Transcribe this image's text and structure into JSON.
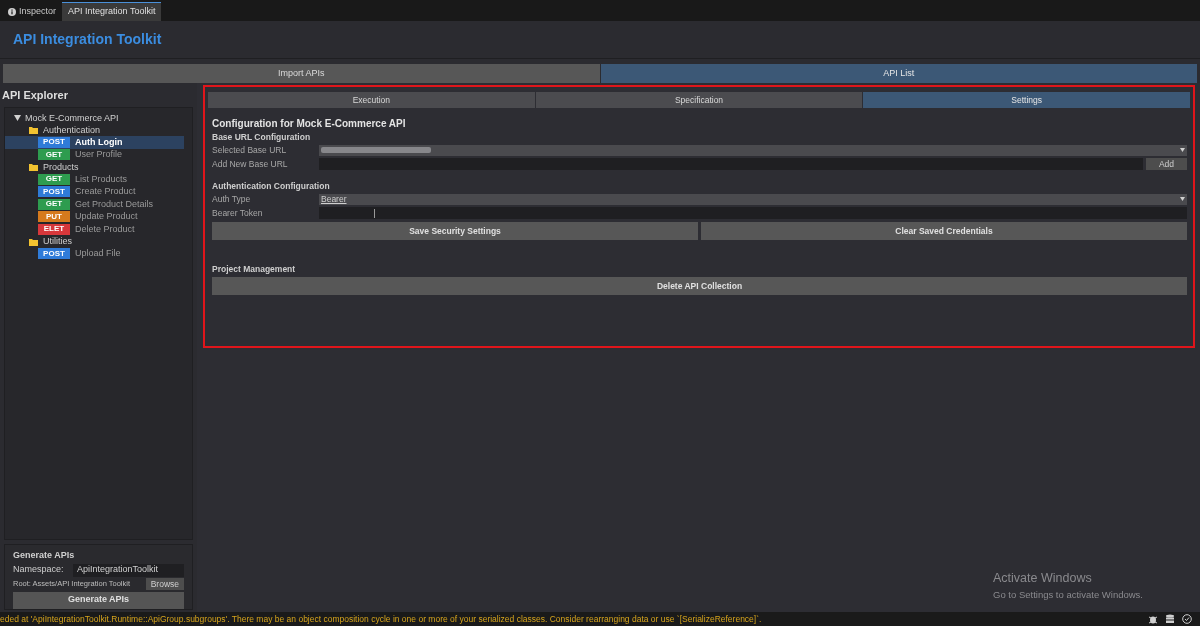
{
  "window_tabs": [
    {
      "label": "Inspector",
      "kind": "info",
      "selected": false
    },
    {
      "label": "API Integration Toolkit",
      "selected": true
    }
  ],
  "header": {
    "title": "API Integration Toolkit"
  },
  "main_tabs": [
    {
      "label": "Import APIs",
      "selected": false
    },
    {
      "label": "API List",
      "selected": true
    }
  ],
  "sidebar": {
    "title": "API Explorer",
    "tree": [
      {
        "label": "Mock E-Commerce API",
        "kind": "root",
        "expanded": true,
        "children": [
          {
            "label": "Authentication",
            "kind": "folder",
            "children": [
              {
                "label": "Auth Login",
                "kind": "endpoint",
                "method": "POST",
                "color": "#2f7bd8",
                "selected": true
              },
              {
                "label": "User Profile",
                "kind": "endpoint",
                "method": "GET",
                "color": "#2e9c4f",
                "selected": false
              }
            ]
          },
          {
            "label": "Products",
            "kind": "folder",
            "children": [
              {
                "label": "List Products",
                "kind": "endpoint",
                "method": "GET",
                "color": "#2e9c4f",
                "selected": false
              },
              {
                "label": "Create Product",
                "kind": "endpoint",
                "method": "POST",
                "color": "#2f7bd8",
                "selected": false
              },
              {
                "label": "Get Product Details",
                "kind": "endpoint",
                "method": "GET",
                "color": "#2e9c4f",
                "selected": false
              },
              {
                "label": "Update Product",
                "kind": "endpoint",
                "method": "PUT",
                "color": "#d67a1d",
                "selected": false
              },
              {
                "label": "Delete Product",
                "kind": "endpoint",
                "method": "ELET",
                "color": "#d7373b",
                "selected": false
              }
            ]
          },
          {
            "label": "Utilities",
            "kind": "folder",
            "children": [
              {
                "label": "Upload File",
                "kind": "endpoint",
                "method": "POST",
                "color": "#2f7bd8",
                "selected": false
              }
            ]
          }
        ]
      }
    ],
    "generate": {
      "title": "Generate APIs",
      "namespace_label": "Namespace:",
      "namespace_value": "ApiIntegrationToolkit",
      "root_label": "Root: Assets/API Integration Toolkit",
      "browse_button": "Browse",
      "generate_button": "Generate APIs"
    }
  },
  "sub_tabs": [
    {
      "label": "Execution",
      "selected": false
    },
    {
      "label": "Specification",
      "selected": false
    },
    {
      "label": "Settings",
      "selected": true
    }
  ],
  "settings": {
    "title": "Configuration for Mock E-Commerce API",
    "base_url_section": "Base URL Configuration",
    "selected_base_url_label": "Selected Base URL",
    "add_base_url_label": "Add New Base URL",
    "add_button": "Add",
    "auth_section": "Authentication Configuration",
    "auth_type_label": "Auth Type",
    "auth_type_value": "Bearer",
    "bearer_token_label": "Bearer Token",
    "save_button": "Save Security Settings",
    "clear_button": "Clear Saved Credentials",
    "project_section": "Project Management",
    "delete_button": "Delete API Collection"
  },
  "watermark": {
    "title": "Activate Windows",
    "subtitle": "Go to Settings to activate Windows."
  },
  "status_bar": {
    "message": "eded at 'ApiIntegrationToolkit.Runtime::ApiGroup.subgroups'. There may be an object composition cycle in one or more of your serialized classes. Consider rearranging data or use `[SerializeReference]`."
  }
}
